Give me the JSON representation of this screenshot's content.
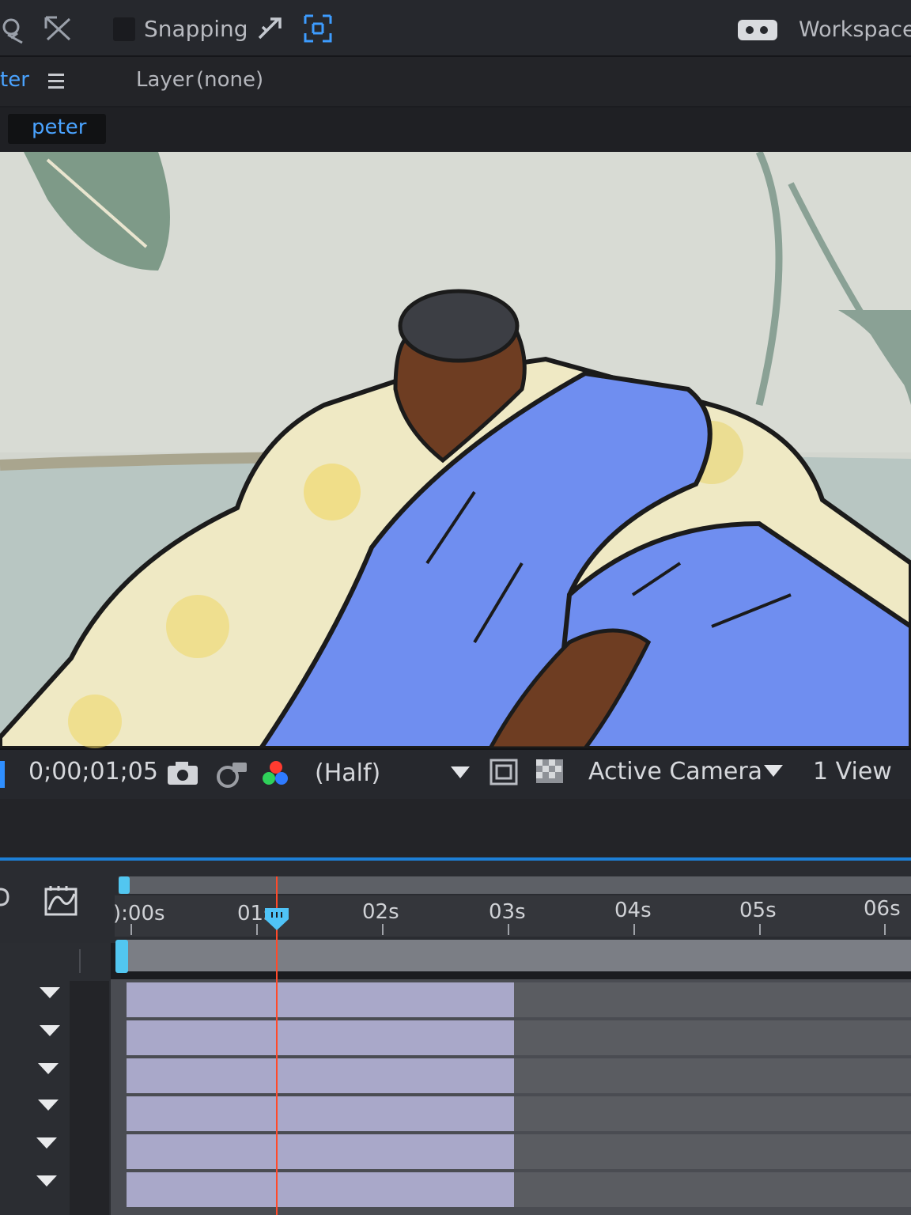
{
  "toolbar": {
    "snapping_label": "Snapping",
    "workspace_label": "Workspace:",
    "icons": [
      "selection-tool-icon",
      "puppet-tool-icon",
      "snap-edges-icon",
      "snap-grid-icon",
      "workspace-toggle-icon"
    ]
  },
  "panel": {
    "comp_tab_label": "ter",
    "layer_label": "Layer",
    "layer_value": "(none)",
    "comp_name": "peter"
  },
  "viewer_bar": {
    "timecode": "0;00;01;05",
    "resolution": "(Half)",
    "camera": "Active Camera",
    "views": "1 View"
  },
  "timeline": {
    "ruler_labels": [
      ":00s",
      "01s",
      "02s",
      "03s",
      "04s",
      "05s",
      "06s"
    ],
    "ruler_first_partial": "):00s",
    "playhead_time_seconds": 1.17,
    "layer_count_visible": 6
  },
  "colors": {
    "accent_blue": "#1d7fd6",
    "playhead": "#ff4a2a",
    "comp_name_blue": "#4aa3ff",
    "layer_bar": "#a9a8c9"
  }
}
